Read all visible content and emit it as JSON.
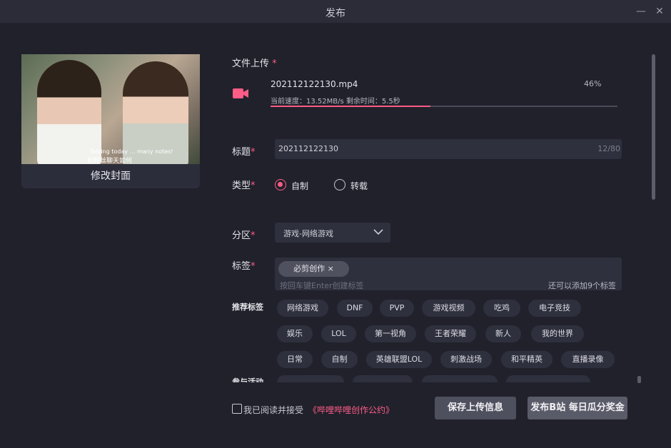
{
  "window": {
    "title": "发布",
    "minimize_icon": "minus-icon",
    "close_icon": "close-icon"
  },
  "cover": {
    "edit_label": "修改封面",
    "subtitle_line1": "Talking today … many notes!",
    "subtitle_line2": "和粉丝聊天如何"
  },
  "upload": {
    "label": "文件上传",
    "required": "*",
    "file_name": "202112122130.mp4",
    "percent_text": "46%",
    "progress": 0.46,
    "speed_text": "当前速度：13.52MB/s  剩余时间：5.5秒",
    "accent": "#ff5c86"
  },
  "title_field": {
    "label": "标题",
    "required": "*",
    "value": "202112122130",
    "counter": "12/80"
  },
  "type_field": {
    "label": "类型",
    "required": "*",
    "options": [
      "自制",
      "转载"
    ],
    "selected": 0
  },
  "category": {
    "label": "分区",
    "required": "*",
    "value": "游戏-网络游戏"
  },
  "tags": {
    "label": "标签",
    "required": "*",
    "chips": [
      "必剪创作 ×"
    ],
    "placeholder": "按回车键Enter创建标签",
    "remaining": "还可以添加9个标签"
  },
  "recommended": {
    "label": "推荐标签",
    "rows": [
      [
        "网络游戏",
        "DNF",
        "PVP",
        "游戏视频",
        "吃鸡",
        "电子竞技"
      ],
      [
        "娱乐",
        "LOL",
        "第一视角",
        "王者荣耀",
        "新人",
        "我的世界"
      ],
      [
        "日常",
        "自制",
        "英雄联盟LOL",
        "刺激战场",
        "和平精英",
        "直播录像"
      ]
    ]
  },
  "activity": {
    "label": "参与活动"
  },
  "footer": {
    "agree_text": "我已阅读并接受",
    "agree_link": "《哔哩哔哩创作公约》",
    "save_button": "保存上传信息",
    "publish_button": "发布B站 每日瓜分奖金"
  }
}
